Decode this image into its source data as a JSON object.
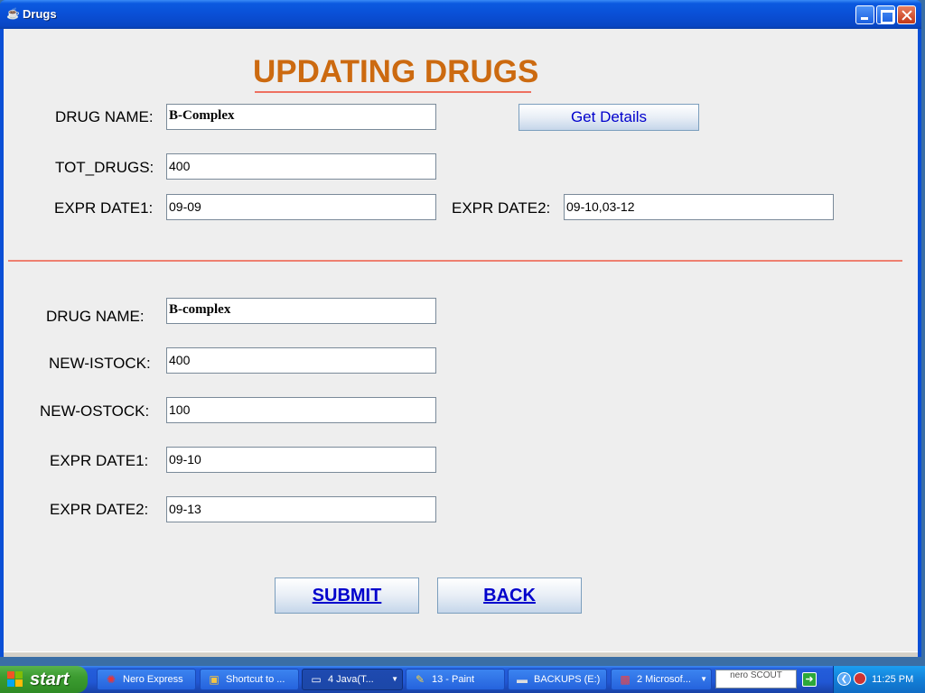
{
  "window": {
    "title": "Drugs",
    "icon": "java-cup-icon"
  },
  "heading": "UPDATING DRUGS",
  "lookup": {
    "drug_name_label": "DRUG NAME:",
    "drug_name_value": "B-Complex",
    "get_details_label": "Get Details",
    "tot_drugs_label": "TOT_DRUGS:",
    "tot_drugs_value": "400",
    "expr_date1_label": "EXPR DATE1:",
    "expr_date1_value": "09-09",
    "expr_date2_label": "EXPR DATE2:",
    "expr_date2_value": "09-10,03-12"
  },
  "update": {
    "drug_name_label": "DRUG NAME:",
    "drug_name_value": "B-complex",
    "new_istock_label": "NEW-ISTOCK:",
    "new_istock_value": "400",
    "new_ostock_label": "NEW-OSTOCK:",
    "new_ostock_value": "100",
    "expr_date1_label": "EXPR DATE1:",
    "expr_date1_value": "09-10",
    "expr_date2_label": "EXPR DATE2:",
    "expr_date2_value": "09-13"
  },
  "buttons": {
    "submit_label": "SUBMIT",
    "back_label": "BACK"
  },
  "taskbar": {
    "start_label": "start",
    "tasks": [
      {
        "label": "Nero Express",
        "icon": "nero-icon"
      },
      {
        "label": "Shortcut to ...",
        "icon": "shortcut-icon"
      },
      {
        "label": "4 Java(T...",
        "icon": "java-window-icon"
      },
      {
        "label": "13 - Paint",
        "icon": "paint-icon"
      },
      {
        "label": "BACKUPS (E:)",
        "icon": "drive-icon"
      },
      {
        "label": "2 Microsof...",
        "icon": "office-icon"
      }
    ],
    "nero_scout": "nero SCOUT",
    "clock": "11:25 PM"
  },
  "colors": {
    "heading": "#cc6a10",
    "divider": "#ee8070",
    "button_text": "#0000cc",
    "titlebar": "#0a4fd6",
    "start_green": "#3c9c31"
  }
}
